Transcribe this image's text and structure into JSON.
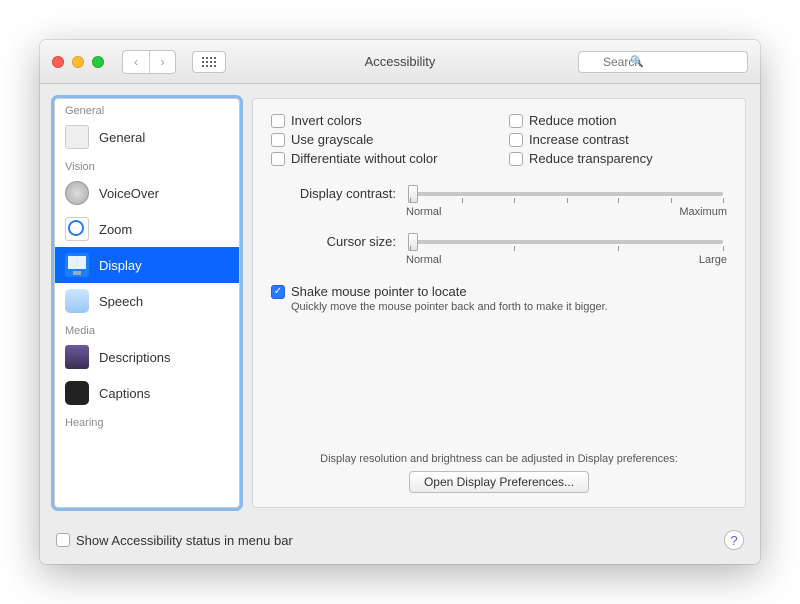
{
  "window": {
    "title": "Accessibility",
    "search_placeholder": "Search"
  },
  "sidebar": {
    "sections": [
      {
        "label": "General",
        "items": [
          {
            "label": "General",
            "selected": false,
            "key": "general"
          }
        ]
      },
      {
        "label": "Vision",
        "items": [
          {
            "label": "VoiceOver",
            "selected": false,
            "key": "voiceover"
          },
          {
            "label": "Zoom",
            "selected": false,
            "key": "zoom"
          },
          {
            "label": "Display",
            "selected": true,
            "key": "display"
          },
          {
            "label": "Speech",
            "selected": false,
            "key": "speech"
          }
        ]
      },
      {
        "label": "Media",
        "items": [
          {
            "label": "Descriptions",
            "selected": false,
            "key": "descriptions"
          },
          {
            "label": "Captions",
            "selected": false,
            "key": "captions"
          }
        ]
      },
      {
        "label": "Hearing",
        "items": []
      }
    ]
  },
  "checkboxes": {
    "invert_colors": {
      "label": "Invert colors",
      "checked": false
    },
    "reduce_motion": {
      "label": "Reduce motion",
      "checked": false
    },
    "use_grayscale": {
      "label": "Use grayscale",
      "checked": false
    },
    "increase_contrast": {
      "label": "Increase contrast",
      "checked": false
    },
    "differentiate": {
      "label": "Differentiate without color",
      "checked": false
    },
    "reduce_transparency": {
      "label": "Reduce transparency",
      "checked": false
    }
  },
  "sliders": {
    "display_contrast": {
      "label": "Display contrast:",
      "min_label": "Normal",
      "max_label": "Maximum",
      "value_pct": 0
    },
    "cursor_size": {
      "label": "Cursor size:",
      "min_label": "Normal",
      "max_label": "Large",
      "value_pct": 0
    }
  },
  "shake": {
    "label": "Shake mouse pointer to locate",
    "checked": true,
    "hint": "Quickly move the mouse pointer back and forth to make it bigger."
  },
  "footer": {
    "text": "Display resolution and brightness can be adjusted in Display preferences:",
    "button": "Open Display Preferences..."
  },
  "bottom": {
    "show_status": {
      "label": "Show Accessibility status in menu bar",
      "checked": false
    },
    "help": "?"
  }
}
